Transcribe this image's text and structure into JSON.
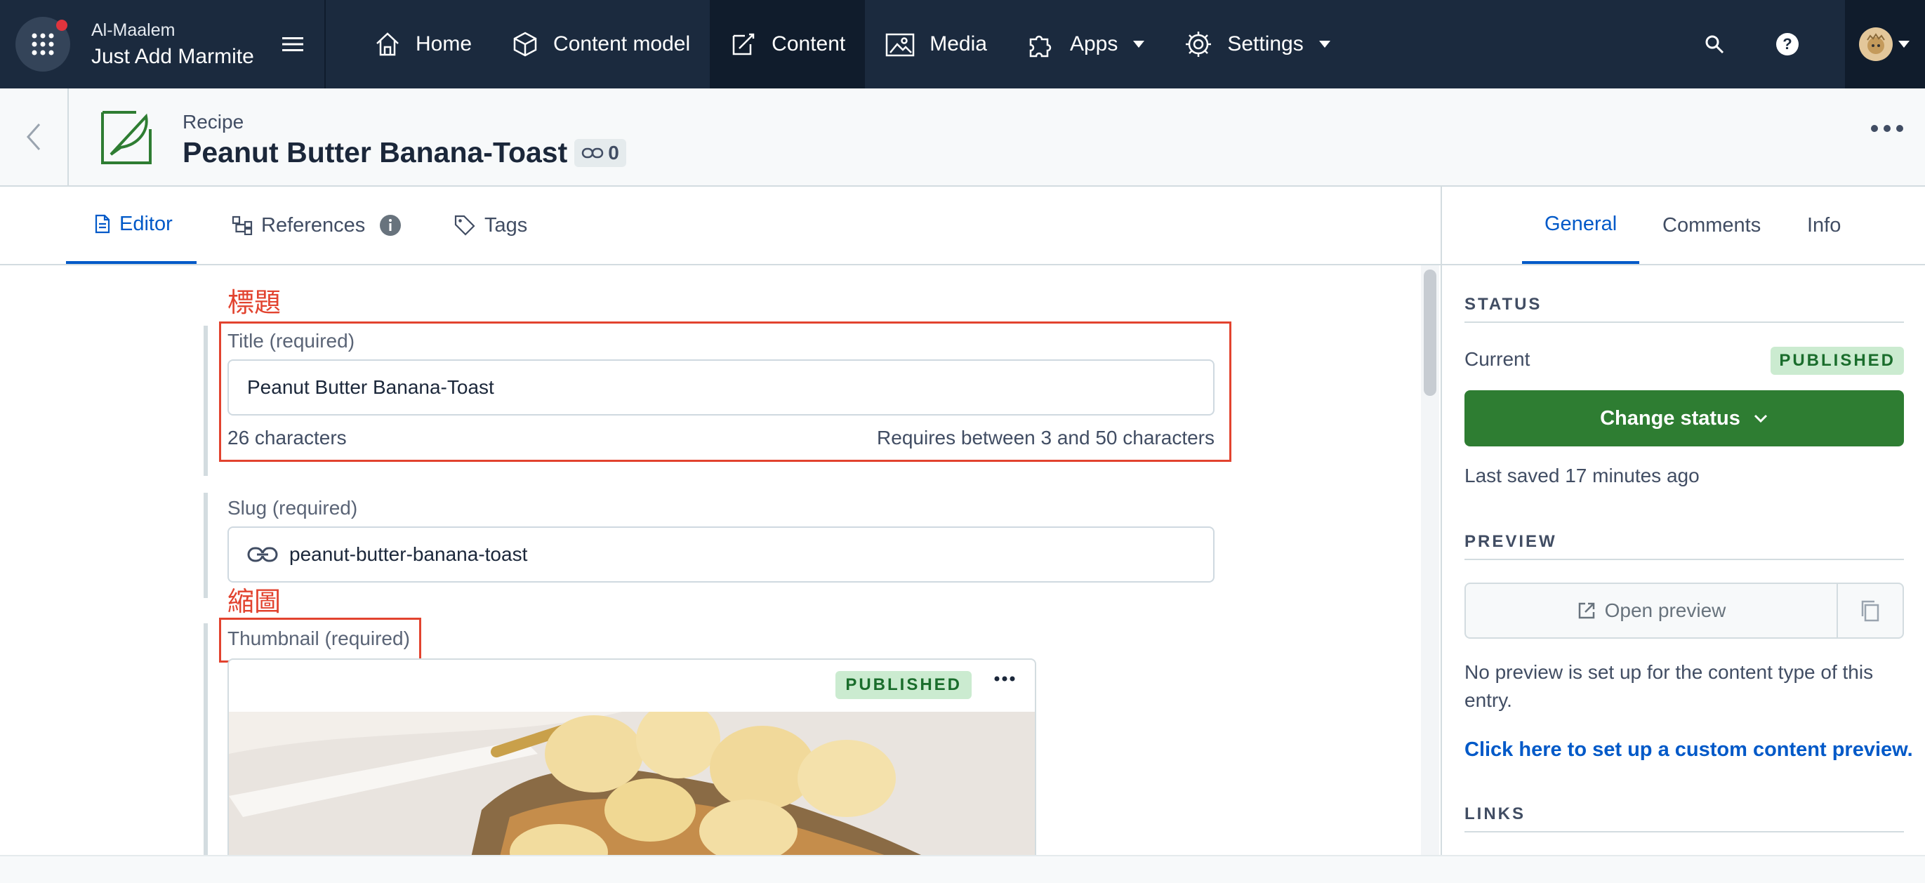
{
  "nav": {
    "org": "Al-Maalem",
    "space": "Just Add Marmite",
    "items": [
      {
        "label": "Home"
      },
      {
        "label": "Content model"
      },
      {
        "label": "Content"
      },
      {
        "label": "Media"
      },
      {
        "label": "Apps"
      },
      {
        "label": "Settings"
      }
    ]
  },
  "entry": {
    "content_type": "Recipe",
    "title": "Peanut Butter Banana-Toast",
    "ref_count": "0"
  },
  "tabs": {
    "editor": "Editor",
    "references": "References",
    "tags": "Tags"
  },
  "side_tabs": {
    "general": "General",
    "comments": "Comments",
    "info": "Info"
  },
  "fields": {
    "title_annotation": "標題",
    "title_label": "Title (required)",
    "title_value": "Peanut Butter Banana-Toast",
    "title_count": "26 characters",
    "title_rule": "Requires between 3 and 50 characters",
    "slug_label": "Slug (required)",
    "slug_value": "peanut-butter-banana-toast",
    "thumb_annotation": "縮圖",
    "thumb_label": "Thumbnail (required)",
    "thumb_status": "PUBLISHED"
  },
  "sidebar": {
    "status_title": "STATUS",
    "current_label": "Current",
    "current_status": "PUBLISHED",
    "change_status": "Change status",
    "last_saved": "Last saved 17 minutes ago",
    "preview_title": "PREVIEW",
    "open_preview": "Open preview",
    "no_preview": "No preview is set up for the content type of this entry.",
    "setup_link": "Click here to set up a custom content preview.",
    "links_title": "LINKS"
  },
  "colors": {
    "nav_bg": "#1b2a3e",
    "accent": "#0059c8",
    "success": "#2e7d32",
    "annotation": "#e2432f"
  }
}
